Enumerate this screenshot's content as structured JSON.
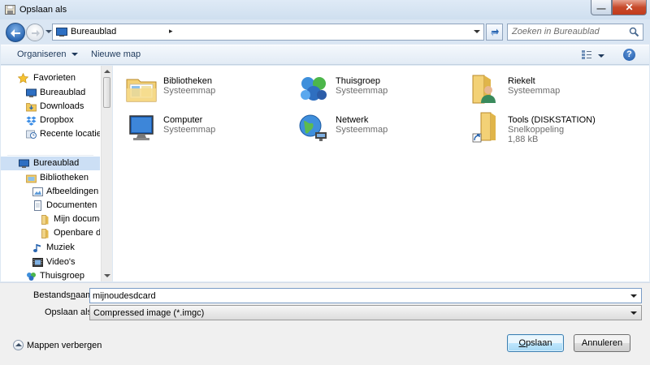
{
  "window": {
    "title": "Opslaan als",
    "minimize_glyph": "—",
    "close_glyph": "✕"
  },
  "address": {
    "crumb": "Bureaublad",
    "separator": "▸"
  },
  "search": {
    "placeholder": "Zoeken in Bureaublad"
  },
  "toolbar": {
    "organize": "Organiseren",
    "new_folder": "Nieuwe map",
    "help_glyph": "?"
  },
  "navpane": {
    "favorites": [
      {
        "label": "Favorieten",
        "icon": "star-icon"
      },
      {
        "label": "Bureaublad",
        "icon": "desktop-icon"
      },
      {
        "label": "Downloads",
        "icon": "downloads-folder-icon"
      },
      {
        "label": "Dropbox",
        "icon": "dropbox-icon"
      },
      {
        "label": "Recente locaties",
        "icon": "recent-places-icon"
      }
    ],
    "tree": [
      {
        "label": "Bureaublad",
        "icon": "desktop-icon",
        "selected": true
      },
      {
        "label": "Bibliotheken",
        "icon": "libraries-icon"
      },
      {
        "label": "Afbeeldingen",
        "icon": "pictures-icon"
      },
      {
        "label": "Documenten",
        "icon": "documents-icon"
      },
      {
        "label": "Mijn docume",
        "icon": "folder-icon"
      },
      {
        "label": "Openbare do",
        "icon": "folder-icon"
      },
      {
        "label": "Muziek",
        "icon": "music-icon"
      },
      {
        "label": "Video's",
        "icon": "videos-icon"
      },
      {
        "label": "Thuisgroep",
        "icon": "homegroup-icon"
      }
    ]
  },
  "items": [
    {
      "name": "Bibliotheken",
      "sub": "Systeemmap",
      "icon": "libraries-icon"
    },
    {
      "name": "Thuisgroep",
      "sub": "Systeemmap",
      "icon": "homegroup-icon"
    },
    {
      "name": "Riekelt",
      "sub": "Systeemmap",
      "icon": "user-folder-icon"
    },
    {
      "name": "Computer",
      "sub": "Systeemmap",
      "icon": "computer-icon"
    },
    {
      "name": "Netwerk",
      "sub": "Systeemmap",
      "icon": "network-icon"
    },
    {
      "name": "Tools (DISKSTATION)",
      "sub": "Snelkoppeling",
      "sub2": "1,88 kB",
      "icon": "shortcut-folder-icon"
    }
  ],
  "form": {
    "filename_label_pre": "Bestands",
    "filename_label_ul": "n",
    "filename_label_post": "aam:",
    "filename_value": "mijnoudesdcard",
    "type_label": "Opslaan als:",
    "type_value": "Compressed image (*.imgc)",
    "hide_folders": "Mappen verbergen",
    "save_ul": "O",
    "save_rest": "pslaan",
    "cancel": "Annuleren"
  }
}
